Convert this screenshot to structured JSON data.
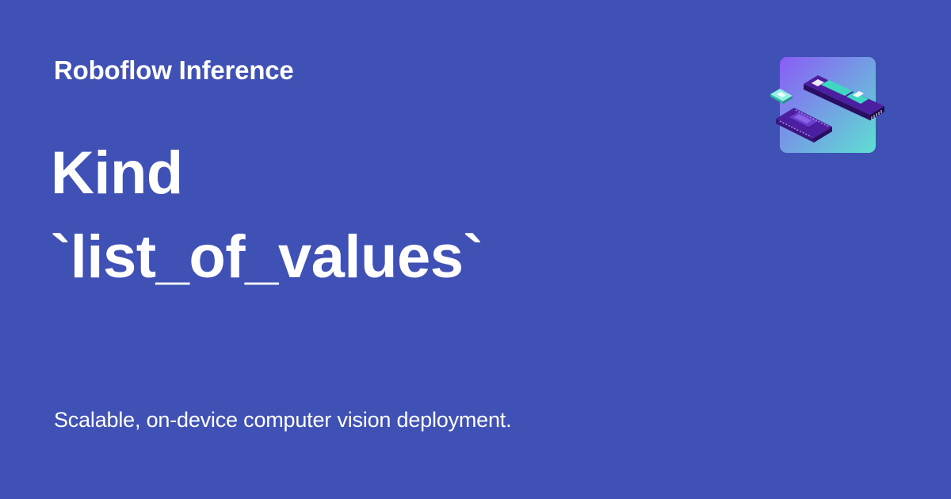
{
  "brand": {
    "site_name": "Roboflow Inference",
    "logo_icon": "isometric-hardware-chips-icon"
  },
  "page": {
    "title_lines": [
      "Kind",
      "`list_of_values`"
    ],
    "tagline": "Scalable, on-device computer vision deployment."
  },
  "colors": {
    "background": "#3f51b5",
    "text": "#ffffff",
    "logo_gradient_start": "#8a5cf6",
    "logo_gradient_end": "#5ee0d2",
    "chip_purple": "#4b1fa0",
    "chip_teal": "#3fd6c2"
  }
}
